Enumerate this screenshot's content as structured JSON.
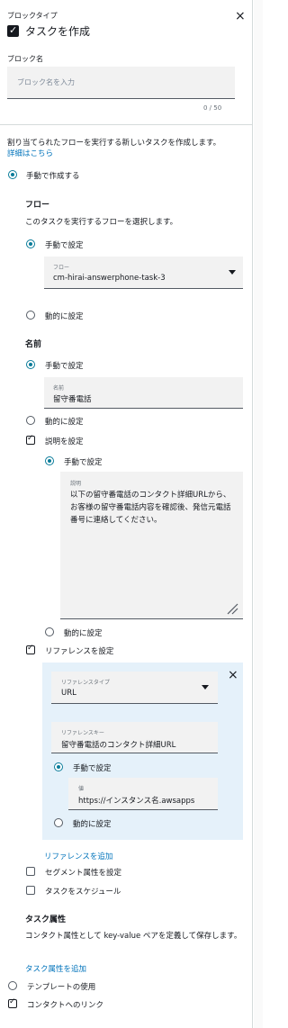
{
  "header": {
    "block_type_label": "ブロックタイプ",
    "block_type_title": "タスクを作成",
    "close_glyph": "×"
  },
  "block_name": {
    "label": "ブロック名",
    "placeholder": "ブロック名を入力",
    "counter": "0 / 50"
  },
  "description": {
    "text": "割り当てられたフローを実行する新しいタスクを作成します。",
    "link": "詳細はこちら"
  },
  "mode": {
    "manual_create": "手動で作成する"
  },
  "flow": {
    "heading": "フロー",
    "desc": "このタスクを実行するフローを選択します。",
    "manual": "手動で設定",
    "field_label": "フロー",
    "field_value": "cm-hirai-answerphone-task-3",
    "dynamic": "動的に設定"
  },
  "name": {
    "heading": "名前",
    "manual": "手動で設定",
    "field_label": "名前",
    "field_value": "留守番電話",
    "dynamic": "動的に設定"
  },
  "desc_setting": {
    "checkbox": "説明を設定",
    "manual": "手動で設定",
    "field_label": "説明",
    "field_value": "以下の留守番電話のコンタクト詳細URLから、お客様の留守番電話内容を確認後、発信元電話番号に連絡してください。",
    "dynamic": "動的に設定"
  },
  "reference": {
    "checkbox": "リファレンスを設定",
    "type_label": "リファレンスタイプ",
    "type_value": "URL",
    "key_label": "リファレンスキー",
    "key_value": "留守番電話のコンタクト詳細URL",
    "manual": "手動で設定",
    "value_label": "値",
    "value_value": "https://インスタンス名.awsapps",
    "dynamic": "動的に設定",
    "add_link": "リファレンスを追加",
    "close_glyph": "×"
  },
  "options": {
    "segment": "セグメント属性を設定",
    "schedule": "タスクをスケジュール"
  },
  "task_attr": {
    "heading": "タスク属性",
    "desc": "コンタクト属性として key-value ペアを定義して保存します。",
    "add_link": "タスク属性を追加"
  },
  "footer": {
    "use_template": "テンプレートの使用",
    "link_contact": "コンタクトへのリンク"
  },
  "colors": {
    "accent": "#0a7c9a",
    "link": "#0073bb",
    "ref_bg": "#e5f1fa",
    "field_bg": "#f2f2f2"
  }
}
